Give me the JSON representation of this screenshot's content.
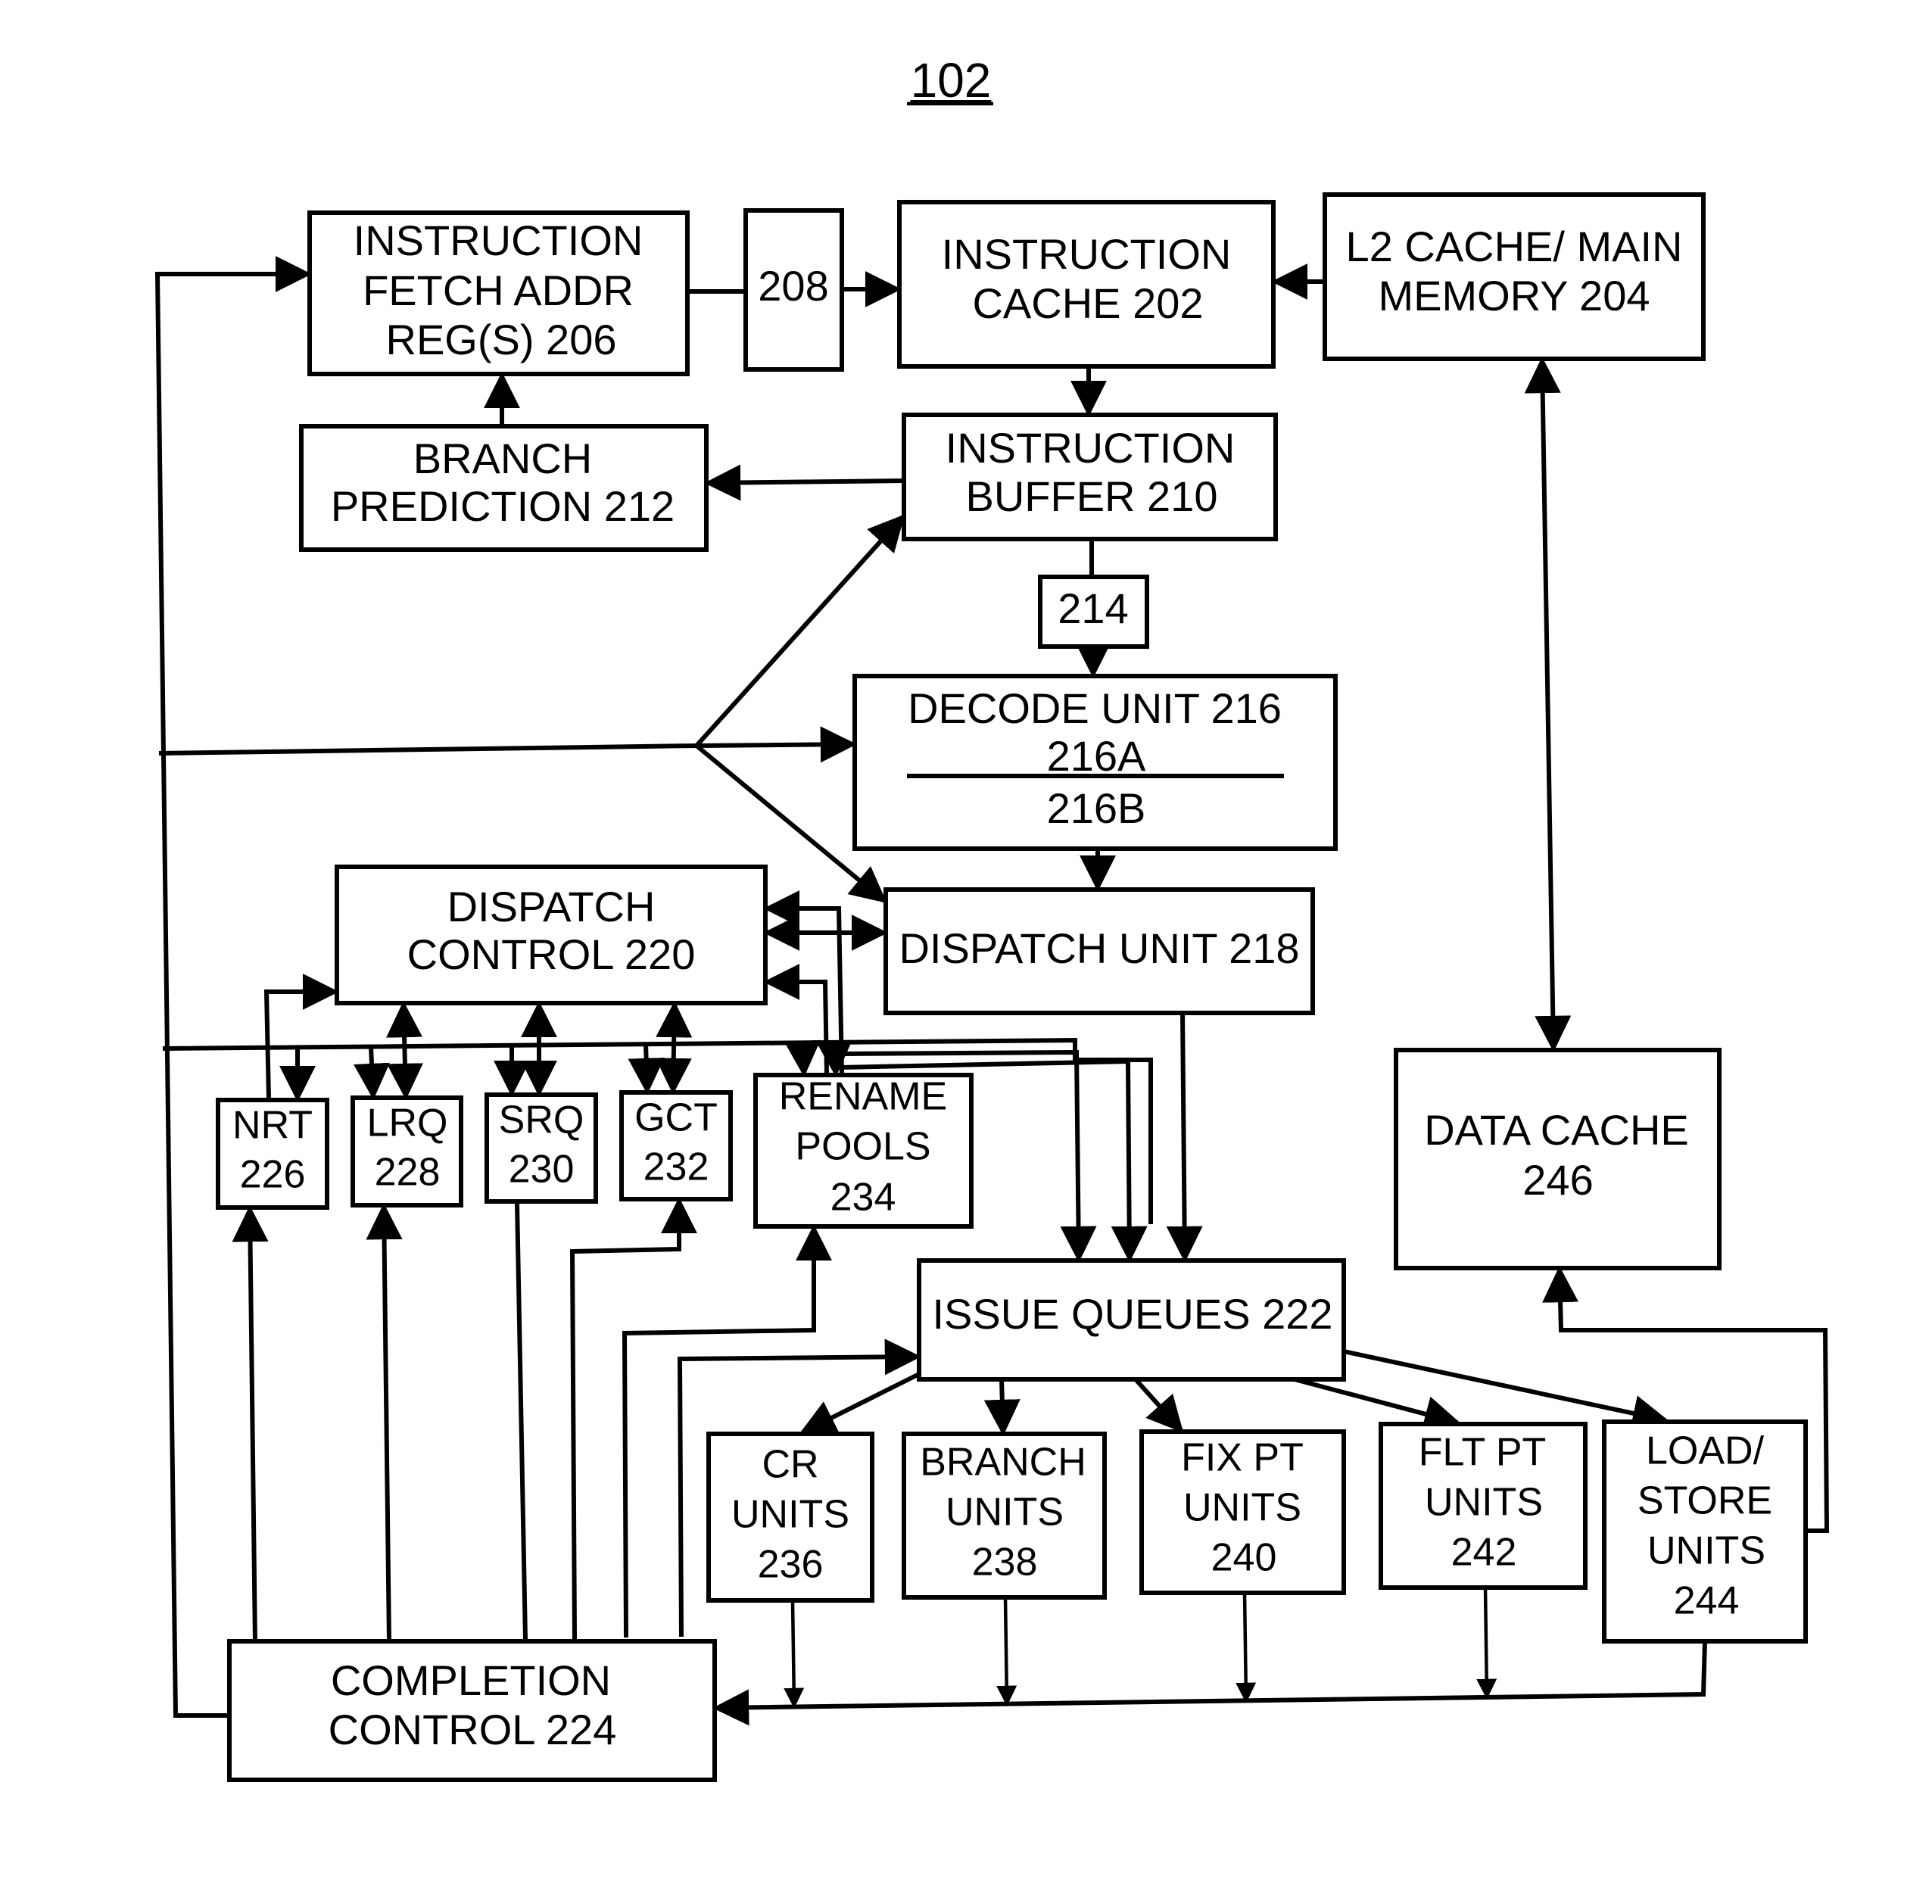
{
  "figure": {
    "title": "102",
    "colors": {
      "ink": "#000000",
      "background": "#ffffff"
    }
  },
  "blocks": {
    "ifar": [
      "INSTRUCTION",
      "FETCH ADDR",
      "REG(S) 206"
    ],
    "b208": [
      "208"
    ],
    "icache": [
      "INSTRUCTION",
      "CACHE 202"
    ],
    "l2": [
      "L2 CACHE/ MAIN",
      "MEMORY 204"
    ],
    "bpred": [
      "BRANCH",
      "PREDICTION 212"
    ],
    "ibuf": [
      "INSTRUCTION",
      "BUFFER 210"
    ],
    "b214": [
      "214"
    ],
    "decode": [
      "DECODE UNIT 216",
      "216A",
      "216B"
    ],
    "dctl": [
      "DISPATCH",
      "CONTROL 220"
    ],
    "dunit": [
      "DISPATCH UNIT 218"
    ],
    "nrt": [
      "NRT",
      "226"
    ],
    "lrq": [
      "LRQ",
      "228"
    ],
    "srq": [
      "SRQ",
      "230"
    ],
    "gct": [
      "GCT",
      "232"
    ],
    "rename": [
      "RENAME",
      "POOLS",
      "234"
    ],
    "dcache": [
      "DATA CACHE",
      "246"
    ],
    "issue": [
      "ISSUE QUEUES 222"
    ],
    "cr": [
      "CR",
      "UNITS",
      "236"
    ],
    "branch": [
      "BRANCH",
      "UNITS",
      "238"
    ],
    "fix": [
      "FIX PT",
      "UNITS",
      "240"
    ],
    "flt": [
      "FLT PT",
      "UNITS",
      "242"
    ],
    "ls": [
      "LOAD/",
      "STORE",
      "UNITS",
      "244"
    ],
    "completion": [
      "COMPLETION",
      "CONTROL 224"
    ]
  }
}
